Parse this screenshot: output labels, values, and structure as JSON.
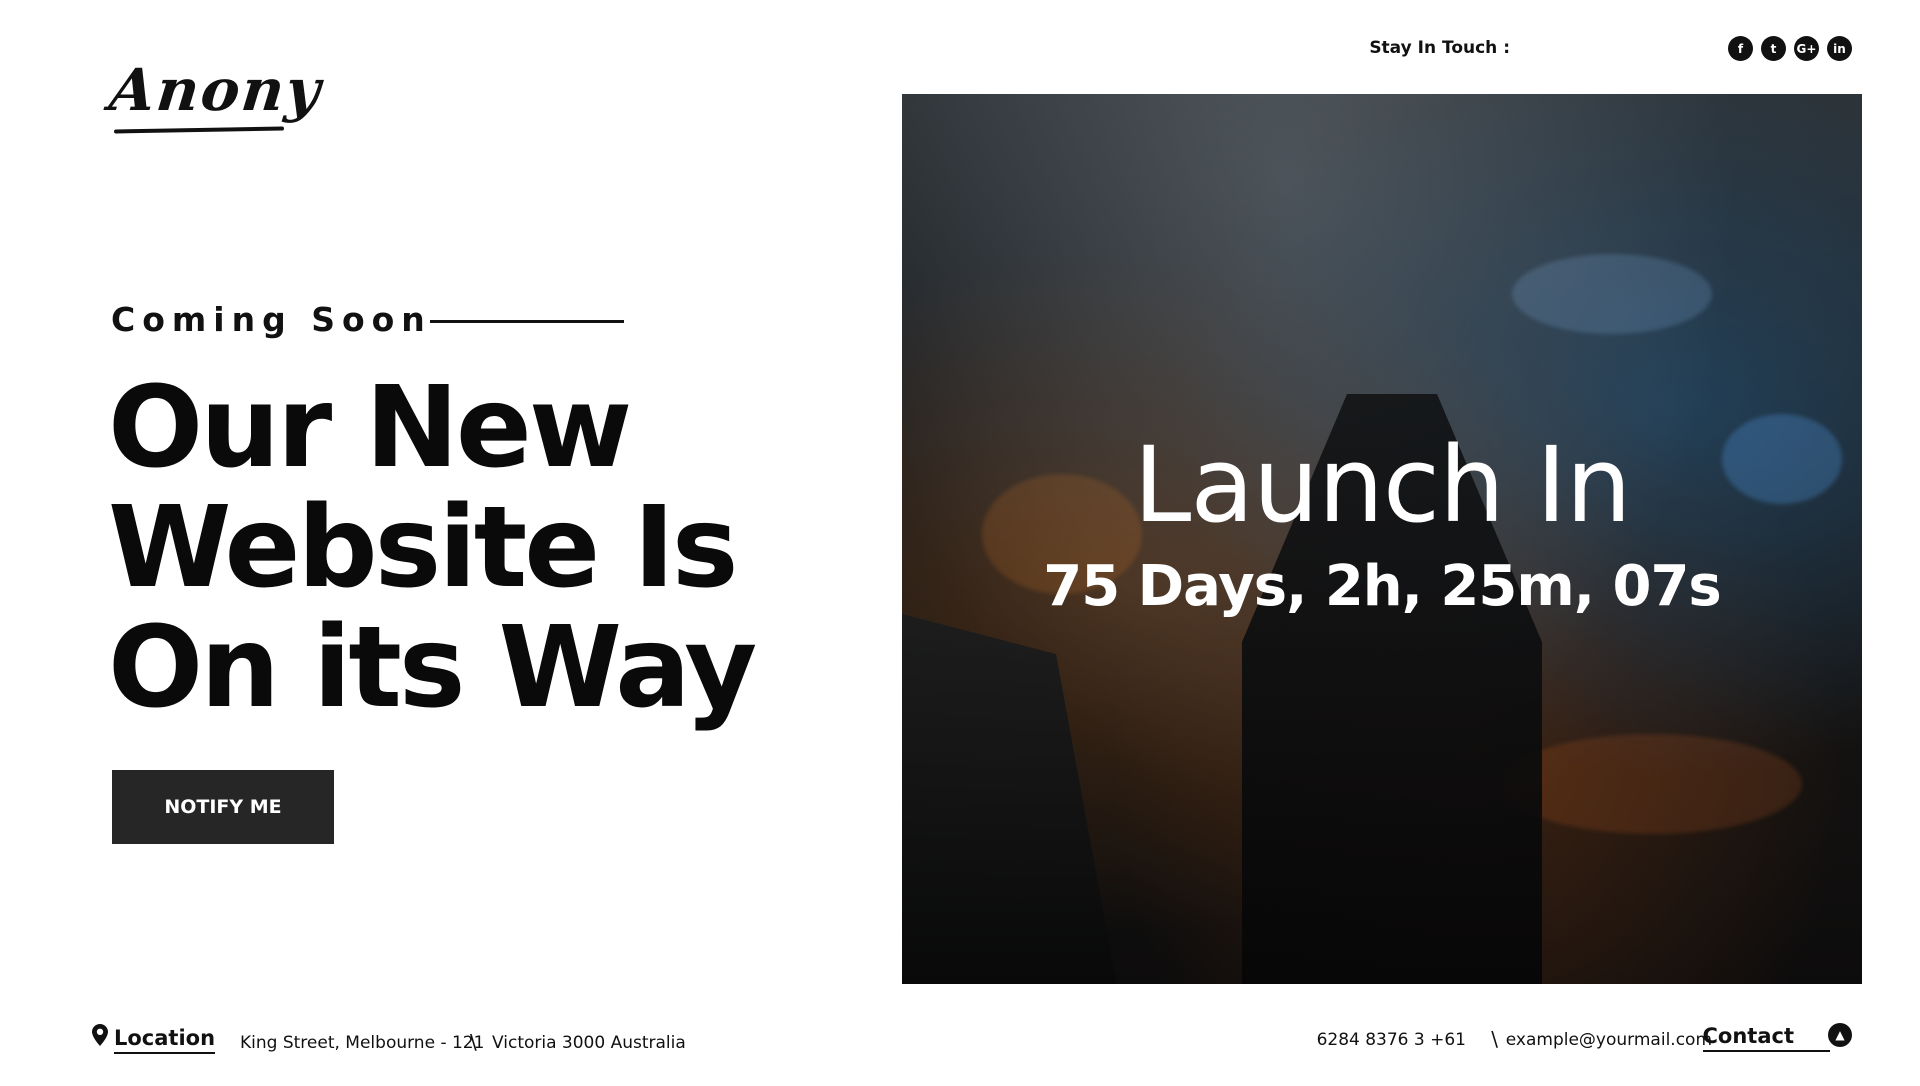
{
  "brand": {
    "logo_text": "Anony"
  },
  "social": {
    "label": "Stay In Touch :",
    "icons": [
      {
        "name": "facebook-icon",
        "glyph": "f"
      },
      {
        "name": "twitter-icon",
        "glyph": "t"
      },
      {
        "name": "google-plus-icon",
        "glyph": "G+"
      },
      {
        "name": "linkedin-icon",
        "glyph": "in"
      }
    ]
  },
  "hero": {
    "kicker": "Coming Soon",
    "headline_line1": "Our New",
    "headline_line2": "Website Is",
    "headline_line3": "On its Way",
    "notify_label": "NOTIFY ME"
  },
  "countdown": {
    "title": "Launch In",
    "value": "75 Days,  2h, 25m, 07s"
  },
  "footer": {
    "location_label": "Location",
    "address_line1": "King Street, Melbourne - 121",
    "separator": "\\",
    "address_line2": "Victoria 3000 Australia",
    "phone": "6284 8376 3 +61",
    "email": "example@yourmail.com",
    "contact_label": "Contact"
  },
  "colors": {
    "text": "#111111",
    "button_bg": "#262626",
    "button_text": "#ffffff",
    "panel_text": "#ffffff"
  }
}
